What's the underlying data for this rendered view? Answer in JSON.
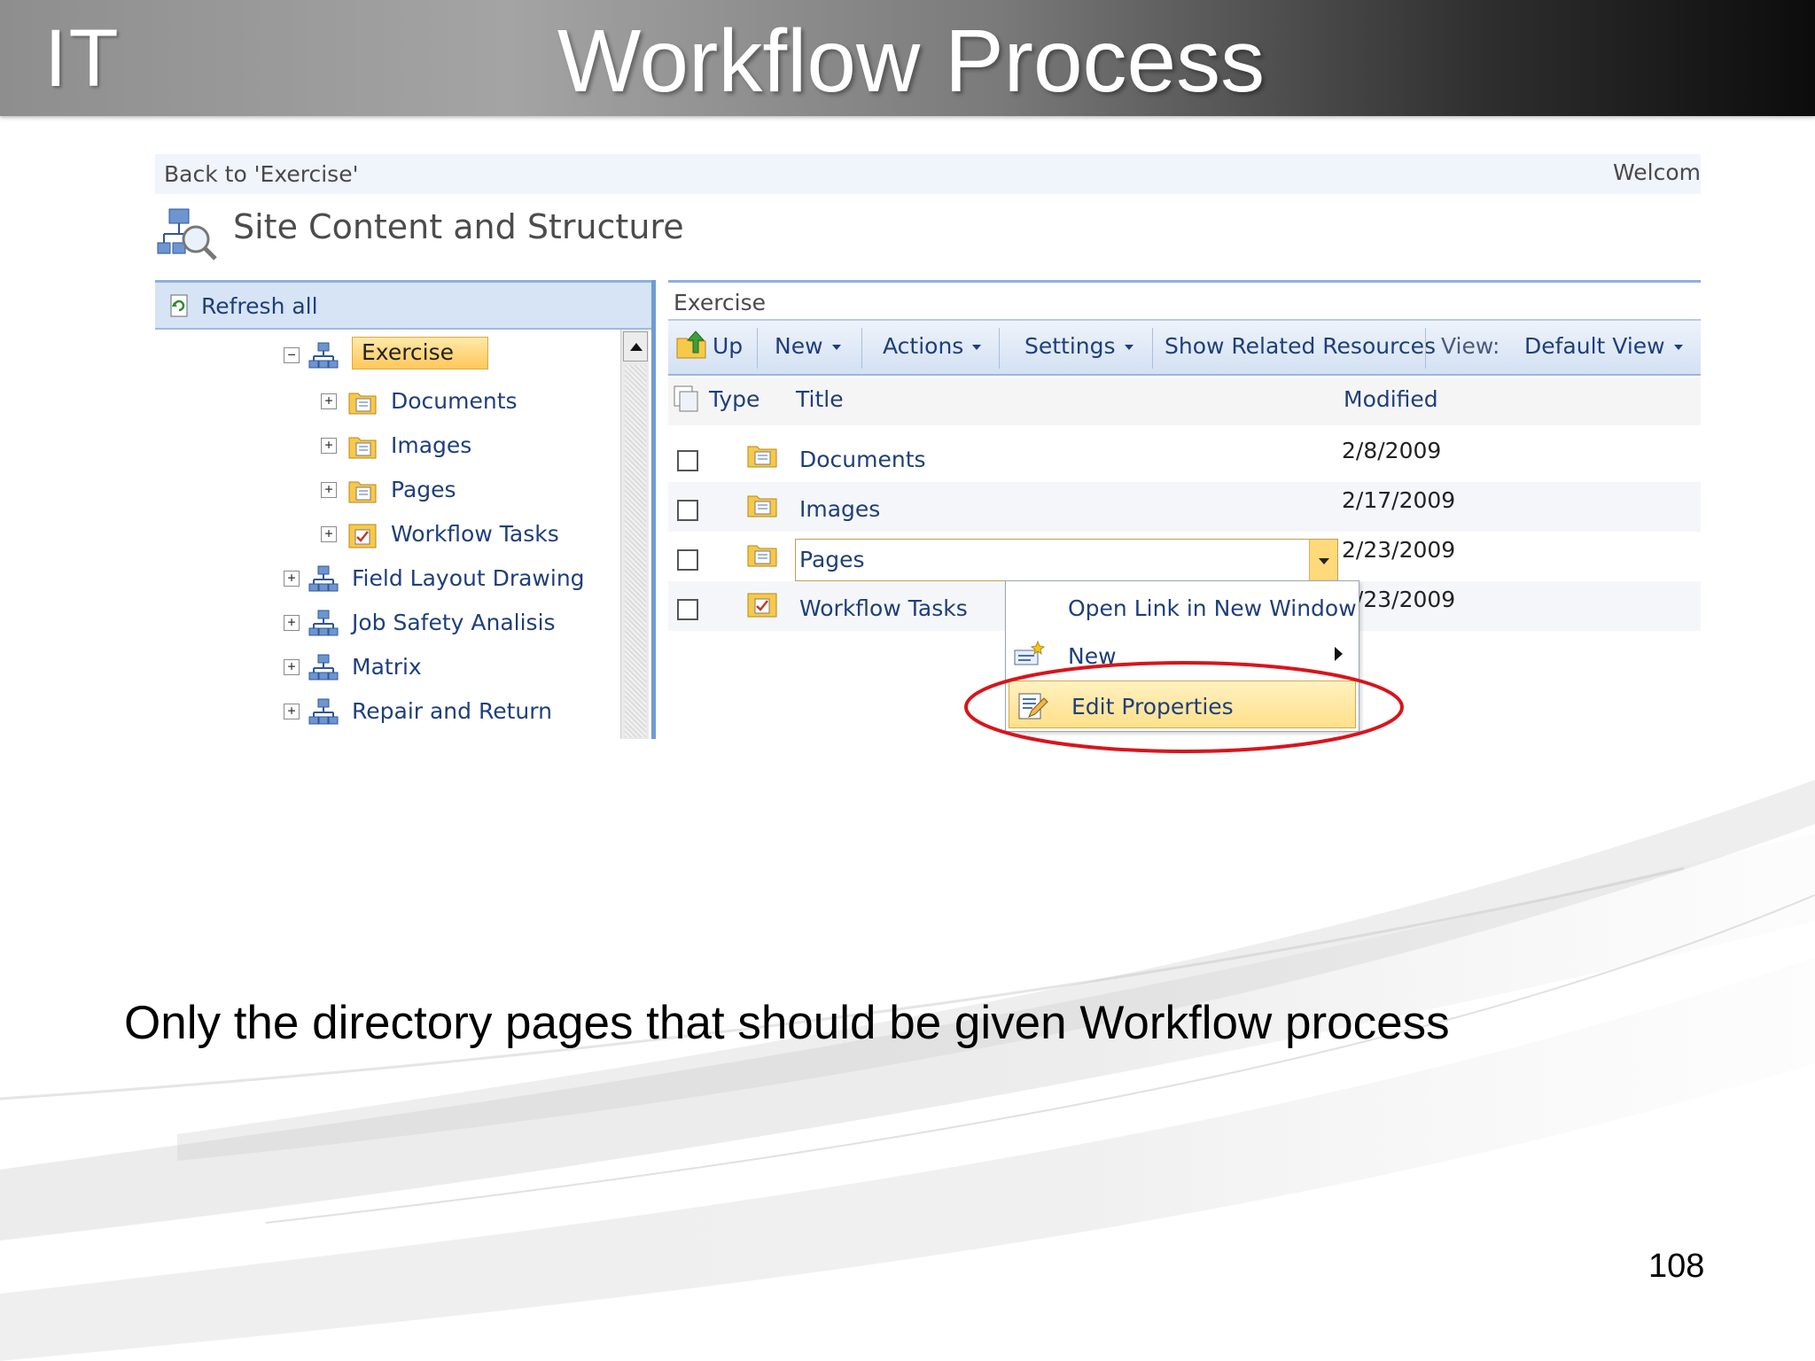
{
  "slide": {
    "logo": "IT",
    "title": "Workflow Process",
    "caption": "Only the directory pages that should be given Workflow process",
    "page_number": "108"
  },
  "screenshot": {
    "topbar": {
      "back_link": "Back to 'Exercise'",
      "welcome": "Welcom"
    },
    "site_title": "Site Content and Structure",
    "left_pane": {
      "refresh_label": "Refresh all",
      "tree": [
        {
          "label": "Exercise",
          "level": 0,
          "expanded": true,
          "selected": true,
          "icon": "site-icon"
        },
        {
          "label": "Documents",
          "level": 1,
          "expanded": false,
          "icon": "library-icon"
        },
        {
          "label": "Images",
          "level": 1,
          "expanded": false,
          "icon": "library-icon"
        },
        {
          "label": "Pages",
          "level": 1,
          "expanded": false,
          "icon": "library-icon"
        },
        {
          "label": "Workflow Tasks",
          "level": 1,
          "expanded": false,
          "icon": "task-list-icon"
        },
        {
          "label": "Field Layout Drawing",
          "level": 0,
          "expanded": false,
          "icon": "site-icon"
        },
        {
          "label": "Job Safety Analisis",
          "level": 0,
          "expanded": false,
          "icon": "site-icon"
        },
        {
          "label": "Matrix",
          "level": 0,
          "expanded": false,
          "icon": "site-icon"
        },
        {
          "label": "Repair and Return",
          "level": 0,
          "expanded": false,
          "icon": "site-icon"
        }
      ]
    },
    "right_pane": {
      "header": "Exercise",
      "toolbar": {
        "up": "Up",
        "new": "New",
        "actions": "Actions",
        "settings": "Settings",
        "show_related": "Show Related Resources",
        "view_label": "View:",
        "view_value": "Default View"
      },
      "columns": {
        "type": "Type",
        "title": "Title",
        "modified": "Modified"
      },
      "rows": [
        {
          "title": "Documents",
          "modified": "2/8/2009",
          "icon": "library-icon"
        },
        {
          "title": "Images",
          "modified": "2/17/2009",
          "icon": "library-icon"
        },
        {
          "title": "Pages",
          "modified": "2/23/2009",
          "icon": "library-icon"
        },
        {
          "title": "Workflow Tasks",
          "modified": "2/23/2009",
          "icon": "task-list-icon"
        }
      ]
    },
    "context_menu": {
      "items": [
        {
          "label": "Open Link in New Window"
        },
        {
          "label": "New",
          "submenu": true
        },
        {
          "label": "Edit Properties",
          "highlighted": true
        }
      ]
    },
    "colors": {
      "link": "#1f3f7a",
      "highlight_ring": "#d9141b",
      "selection": "#ffd97a",
      "pane_border": "#6f9bd6"
    }
  }
}
